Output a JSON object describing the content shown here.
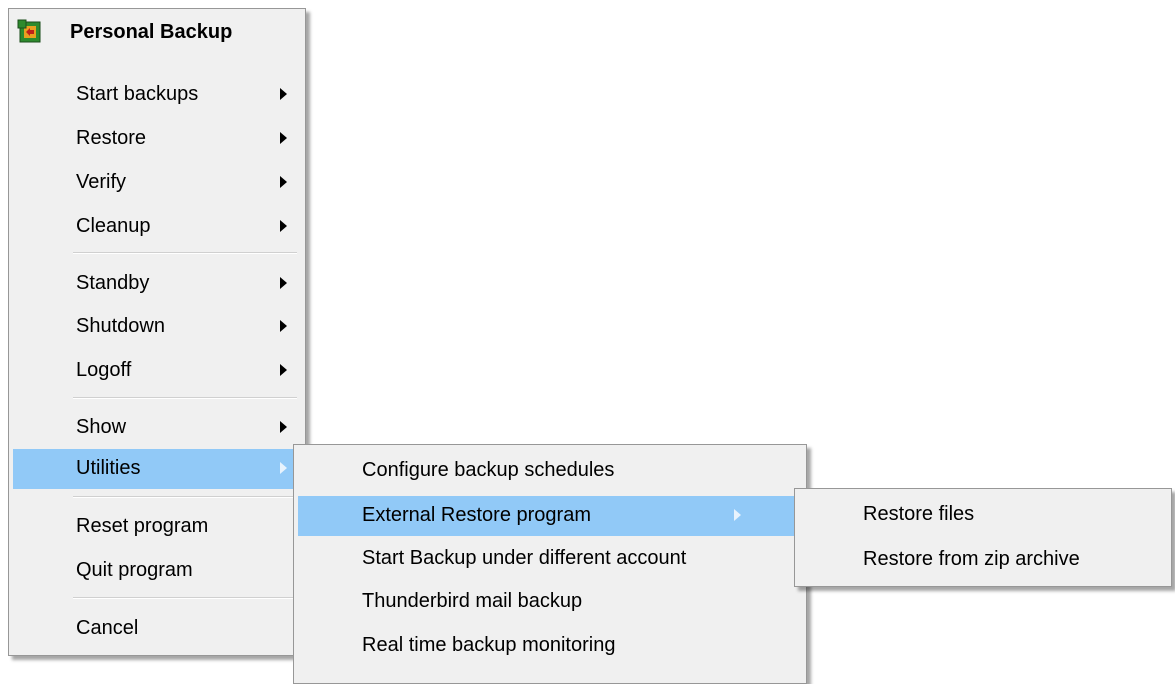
{
  "main_menu": {
    "title": "Personal Backup",
    "title_icon": "personal-backup-app-icon",
    "items": [
      {
        "label": "Start backups",
        "submenu": true
      },
      {
        "label": "Restore",
        "submenu": true
      },
      {
        "label": "Verify",
        "submenu": true
      },
      {
        "label": "Cleanup",
        "submenu": true
      },
      {
        "label": "Standby",
        "submenu": true
      },
      {
        "label": "Shutdown",
        "submenu": true
      },
      {
        "label": "Logoff",
        "submenu": true
      },
      {
        "label": "Show",
        "submenu": true
      },
      {
        "label": "Utilities",
        "submenu": true,
        "highlighted": true
      },
      {
        "label": "Reset program",
        "submenu": false
      },
      {
        "label": "Quit program",
        "submenu": false
      },
      {
        "label": "Cancel",
        "submenu": false
      }
    ]
  },
  "utilities_menu": {
    "items": [
      {
        "label": "Configure backup schedules",
        "submenu": false
      },
      {
        "label": "External Restore program",
        "submenu": true,
        "highlighted": true
      },
      {
        "label": "Start Backup under different account",
        "submenu": false
      },
      {
        "label": "Thunderbird mail backup",
        "submenu": false
      },
      {
        "label": "Real time backup monitoring",
        "submenu": false
      }
    ]
  },
  "restore_menu": {
    "items": [
      {
        "label": "Restore files"
      },
      {
        "label": "Restore from zip archive"
      }
    ]
  },
  "colors": {
    "menu_background": "#f0f0f0",
    "highlight": "#91c9f7",
    "border": "#979797"
  }
}
